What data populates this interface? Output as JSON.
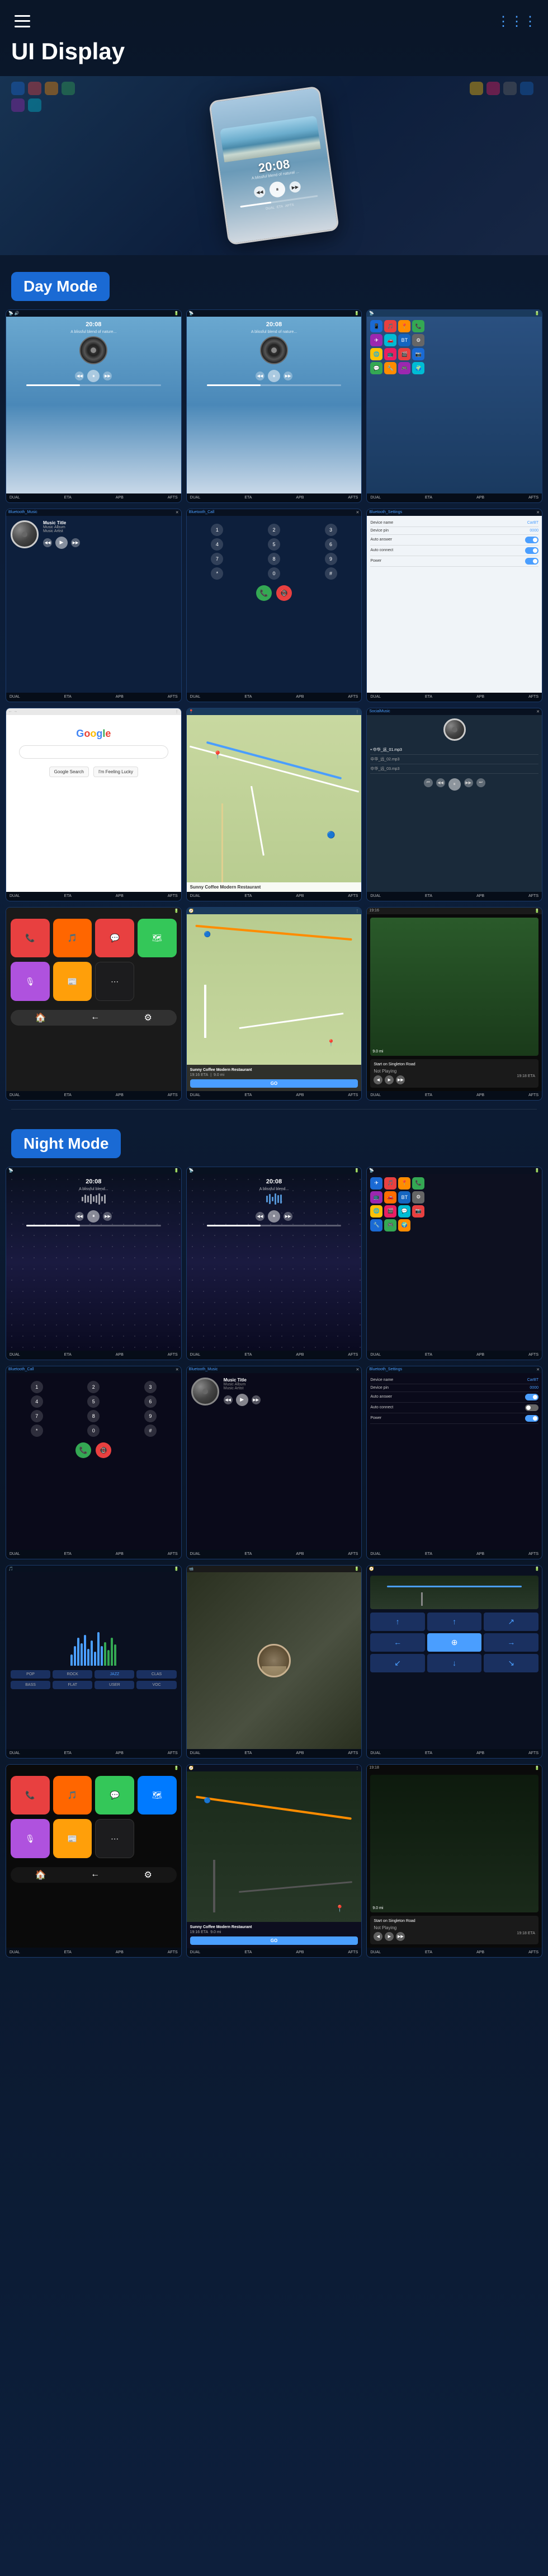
{
  "header": {
    "title": "UI Display",
    "menu_icon": "☰",
    "nav_icon": "≡"
  },
  "day_mode": {
    "label": "Day Mode"
  },
  "night_mode": {
    "label": "Night Mode"
  },
  "music": {
    "title": "Music Title",
    "album": "Music Album",
    "artist": "Music Artist",
    "time": "20:08"
  },
  "bluetooth": {
    "music_label": "Bluetooth_Music",
    "call_label": "Bluetooth_Call",
    "settings_label": "Bluetooth_Settings",
    "device_name_label": "Device name",
    "device_name_val": "CarBT",
    "device_pin_label": "Device pin",
    "device_pin_val": "0000",
    "auto_answer_label": "Auto answer",
    "auto_connect_label": "Auto connect",
    "power_label": "Power"
  },
  "navigation": {
    "restaurant": "Sunny Coffee Modern Restaurant",
    "eta_label": "19:16 ETA",
    "distance": "9.0 mi",
    "go_btn": "GO",
    "start_label": "Start on Singleton Road",
    "not_playing": "Not Playing"
  },
  "status_bars": {
    "items": [
      "DUAL",
      "ETA",
      "APB",
      "AFTS"
    ]
  }
}
